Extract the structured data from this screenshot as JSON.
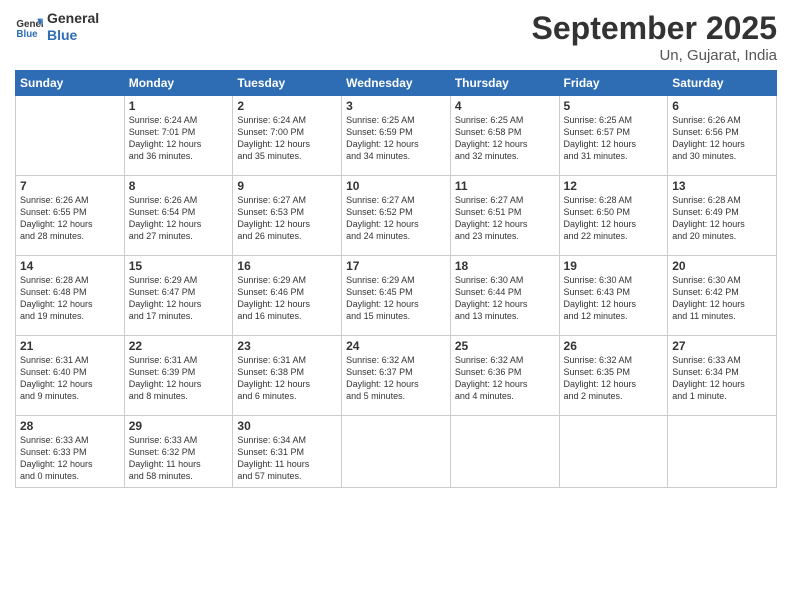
{
  "header": {
    "logo_line1": "General",
    "logo_line2": "Blue",
    "title": "September 2025",
    "subtitle": "Un, Gujarat, India"
  },
  "columns": [
    "Sunday",
    "Monday",
    "Tuesday",
    "Wednesday",
    "Thursday",
    "Friday",
    "Saturday"
  ],
  "weeks": [
    [
      {
        "day": "",
        "info": ""
      },
      {
        "day": "1",
        "info": "Sunrise: 6:24 AM\nSunset: 7:01 PM\nDaylight: 12 hours\nand 36 minutes."
      },
      {
        "day": "2",
        "info": "Sunrise: 6:24 AM\nSunset: 7:00 PM\nDaylight: 12 hours\nand 35 minutes."
      },
      {
        "day": "3",
        "info": "Sunrise: 6:25 AM\nSunset: 6:59 PM\nDaylight: 12 hours\nand 34 minutes."
      },
      {
        "day": "4",
        "info": "Sunrise: 6:25 AM\nSunset: 6:58 PM\nDaylight: 12 hours\nand 32 minutes."
      },
      {
        "day": "5",
        "info": "Sunrise: 6:25 AM\nSunset: 6:57 PM\nDaylight: 12 hours\nand 31 minutes."
      },
      {
        "day": "6",
        "info": "Sunrise: 6:26 AM\nSunset: 6:56 PM\nDaylight: 12 hours\nand 30 minutes."
      }
    ],
    [
      {
        "day": "7",
        "info": "Sunrise: 6:26 AM\nSunset: 6:55 PM\nDaylight: 12 hours\nand 28 minutes."
      },
      {
        "day": "8",
        "info": "Sunrise: 6:26 AM\nSunset: 6:54 PM\nDaylight: 12 hours\nand 27 minutes."
      },
      {
        "day": "9",
        "info": "Sunrise: 6:27 AM\nSunset: 6:53 PM\nDaylight: 12 hours\nand 26 minutes."
      },
      {
        "day": "10",
        "info": "Sunrise: 6:27 AM\nSunset: 6:52 PM\nDaylight: 12 hours\nand 24 minutes."
      },
      {
        "day": "11",
        "info": "Sunrise: 6:27 AM\nSunset: 6:51 PM\nDaylight: 12 hours\nand 23 minutes."
      },
      {
        "day": "12",
        "info": "Sunrise: 6:28 AM\nSunset: 6:50 PM\nDaylight: 12 hours\nand 22 minutes."
      },
      {
        "day": "13",
        "info": "Sunrise: 6:28 AM\nSunset: 6:49 PM\nDaylight: 12 hours\nand 20 minutes."
      }
    ],
    [
      {
        "day": "14",
        "info": "Sunrise: 6:28 AM\nSunset: 6:48 PM\nDaylight: 12 hours\nand 19 minutes."
      },
      {
        "day": "15",
        "info": "Sunrise: 6:29 AM\nSunset: 6:47 PM\nDaylight: 12 hours\nand 17 minutes."
      },
      {
        "day": "16",
        "info": "Sunrise: 6:29 AM\nSunset: 6:46 PM\nDaylight: 12 hours\nand 16 minutes."
      },
      {
        "day": "17",
        "info": "Sunrise: 6:29 AM\nSunset: 6:45 PM\nDaylight: 12 hours\nand 15 minutes."
      },
      {
        "day": "18",
        "info": "Sunrise: 6:30 AM\nSunset: 6:44 PM\nDaylight: 12 hours\nand 13 minutes."
      },
      {
        "day": "19",
        "info": "Sunrise: 6:30 AM\nSunset: 6:43 PM\nDaylight: 12 hours\nand 12 minutes."
      },
      {
        "day": "20",
        "info": "Sunrise: 6:30 AM\nSunset: 6:42 PM\nDaylight: 12 hours\nand 11 minutes."
      }
    ],
    [
      {
        "day": "21",
        "info": "Sunrise: 6:31 AM\nSunset: 6:40 PM\nDaylight: 12 hours\nand 9 minutes."
      },
      {
        "day": "22",
        "info": "Sunrise: 6:31 AM\nSunset: 6:39 PM\nDaylight: 12 hours\nand 8 minutes."
      },
      {
        "day": "23",
        "info": "Sunrise: 6:31 AM\nSunset: 6:38 PM\nDaylight: 12 hours\nand 6 minutes."
      },
      {
        "day": "24",
        "info": "Sunrise: 6:32 AM\nSunset: 6:37 PM\nDaylight: 12 hours\nand 5 minutes."
      },
      {
        "day": "25",
        "info": "Sunrise: 6:32 AM\nSunset: 6:36 PM\nDaylight: 12 hours\nand 4 minutes."
      },
      {
        "day": "26",
        "info": "Sunrise: 6:32 AM\nSunset: 6:35 PM\nDaylight: 12 hours\nand 2 minutes."
      },
      {
        "day": "27",
        "info": "Sunrise: 6:33 AM\nSunset: 6:34 PM\nDaylight: 12 hours\nand 1 minute."
      }
    ],
    [
      {
        "day": "28",
        "info": "Sunrise: 6:33 AM\nSunset: 6:33 PM\nDaylight: 12 hours\nand 0 minutes."
      },
      {
        "day": "29",
        "info": "Sunrise: 6:33 AM\nSunset: 6:32 PM\nDaylight: 11 hours\nand 58 minutes."
      },
      {
        "day": "30",
        "info": "Sunrise: 6:34 AM\nSunset: 6:31 PM\nDaylight: 11 hours\nand 57 minutes."
      },
      {
        "day": "",
        "info": ""
      },
      {
        "day": "",
        "info": ""
      },
      {
        "day": "",
        "info": ""
      },
      {
        "day": "",
        "info": ""
      }
    ]
  ]
}
